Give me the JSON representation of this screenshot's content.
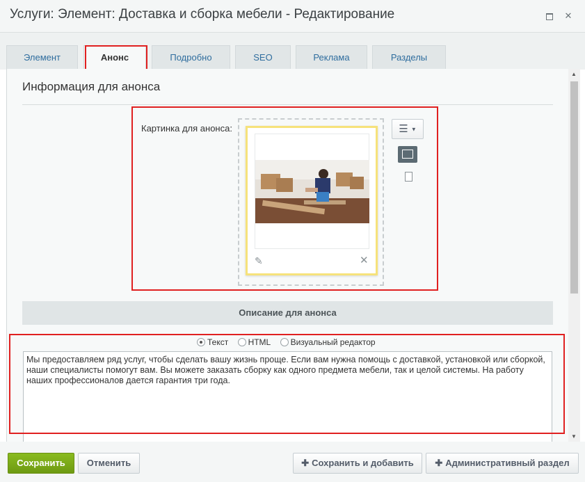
{
  "window": {
    "title": "Услуги: Элемент: Доставка и сборка мебели - Редактирование"
  },
  "tabs": [
    {
      "label": "Элемент"
    },
    {
      "label": "Анонс"
    },
    {
      "label": "Подробно"
    },
    {
      "label": "SEO"
    },
    {
      "label": "Реклама"
    },
    {
      "label": "Разделы"
    }
  ],
  "active_tab": "Анонс",
  "section": {
    "title": "Информация для анонса",
    "picture_label": "Картинка для анонса:",
    "description_header": "Описание для анонса"
  },
  "editor_modes": {
    "text": "Текст",
    "html": "HTML",
    "visual": "Визуальный редактор",
    "selected": "Текст"
  },
  "description_text": "Мы предоставляем ряд услуг, чтобы сделать вашу жизнь проще. Если вам нужна помощь с доставкой, установкой или сборкой, наши специалисты помогут вам. Вы можете заказать сборку как одного предмета мебели, так и целой системы. На работу наших профессионалов дается гарантия три года.",
  "footer": {
    "save": "Сохранить",
    "cancel": "Отменить",
    "save_add": "Сохранить и добавить",
    "admin": "Административный раздел"
  },
  "colors": {
    "accent": "#7cad18",
    "highlight": "#e02020"
  }
}
